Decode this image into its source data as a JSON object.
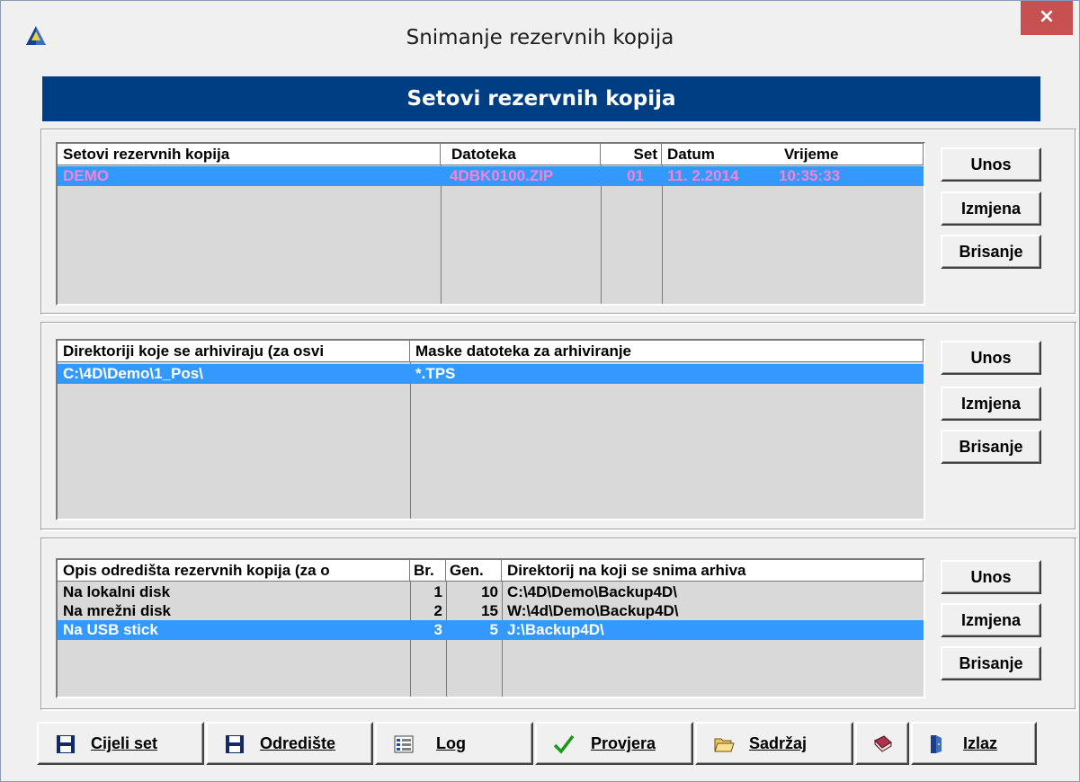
{
  "window": {
    "title": "Snimanje rezervnih kopija",
    "close_glyph": "×"
  },
  "banner": "Setovi rezervnih kopija",
  "sets": {
    "headers": [
      "Setovi rezervnih kopija",
      "Datoteka",
      "Set",
      "Datum",
      "Vrijeme"
    ],
    "rows": [
      {
        "name": "DEMO",
        "file": "4DBK0100.ZIP",
        "set": "01",
        "date": "11. 2.2014",
        "time": "10:35:33"
      }
    ],
    "buttons": [
      "Unos",
      "Izmjena",
      "Brisanje"
    ]
  },
  "dirs": {
    "headers": [
      "Direktoriji koje se arhiviraju (za osvi",
      "Maske datoteka za arhiviranje"
    ],
    "rows": [
      {
        "dir": "C:\\4D\\Demo\\1_Pos\\",
        "mask": "*.TPS"
      }
    ],
    "buttons": [
      "Unos",
      "Izmjena",
      "Brisanje"
    ]
  },
  "dest": {
    "headers": [
      "Opis odredišta rezervnih kopija (za o",
      "Br.",
      "Gen.",
      "Direktorij na koji se snima arhiva"
    ],
    "rows": [
      {
        "desc": "Na lokalni disk",
        "br": "1",
        "gen": "10",
        "dir": "C:\\4D\\Demo\\Backup4D\\"
      },
      {
        "desc": "Na mrežni disk",
        "br": "2",
        "gen": "15",
        "dir": "W:\\4d\\Demo\\Backup4D\\"
      },
      {
        "desc": "Na USB stick",
        "br": "3",
        "gen": "5",
        "dir": "J:\\Backup4D\\"
      }
    ],
    "buttons": [
      "Unos",
      "Izmjena",
      "Brisanje"
    ]
  },
  "bottom": {
    "full_set": "Cijeli set",
    "destination": "Odredište",
    "log": "Log",
    "check": "Provjera",
    "content": "Sadržaj",
    "exit": "Izlaz"
  },
  "colors": {
    "banner": "#003e83",
    "selection": "#3399ff",
    "selected_text_set": "#ff7fd0",
    "close": "#c75050"
  },
  "icons": [
    "app-pyramid-icon",
    "floppy-disk-icon",
    "log-list-icon",
    "checkmark-icon",
    "open-folder-icon",
    "book-icon",
    "door-exit-icon"
  ]
}
